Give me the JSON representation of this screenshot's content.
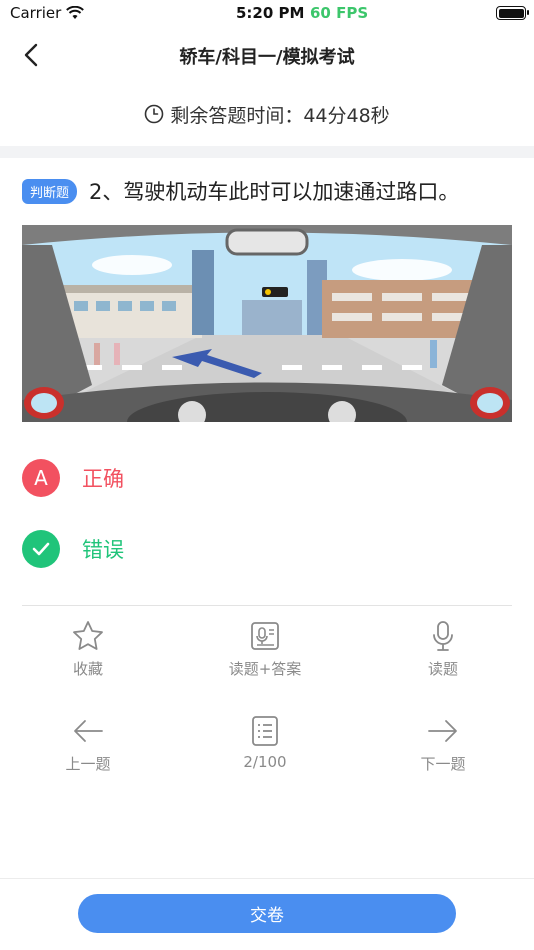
{
  "status_bar": {
    "carrier": "Carrier",
    "time": "5:20 PM",
    "fps": "60 FPS"
  },
  "nav": {
    "title": "轿车/科目一/模拟考试"
  },
  "timer": {
    "text": "剩余答题时间：44分48秒"
  },
  "question": {
    "type_badge": "判断题",
    "text": "2、驾驶机动车此时可以加速通过路口。"
  },
  "options": [
    {
      "letter": "A",
      "label": "正确",
      "state": "wrong"
    },
    {
      "letter": "✓",
      "label": "错误",
      "state": "correct"
    }
  ],
  "tools": {
    "favorite": "收藏",
    "read_with_answer": "读题+答案",
    "read": "读题",
    "prev": "上一题",
    "progress": "2/100",
    "next": "下一题"
  },
  "footer": {
    "submit": "交卷"
  },
  "colors": {
    "accent": "#4a8ef0",
    "wrong": "#f25160",
    "correct": "#20c47a",
    "fps": "#3cc66b"
  }
}
